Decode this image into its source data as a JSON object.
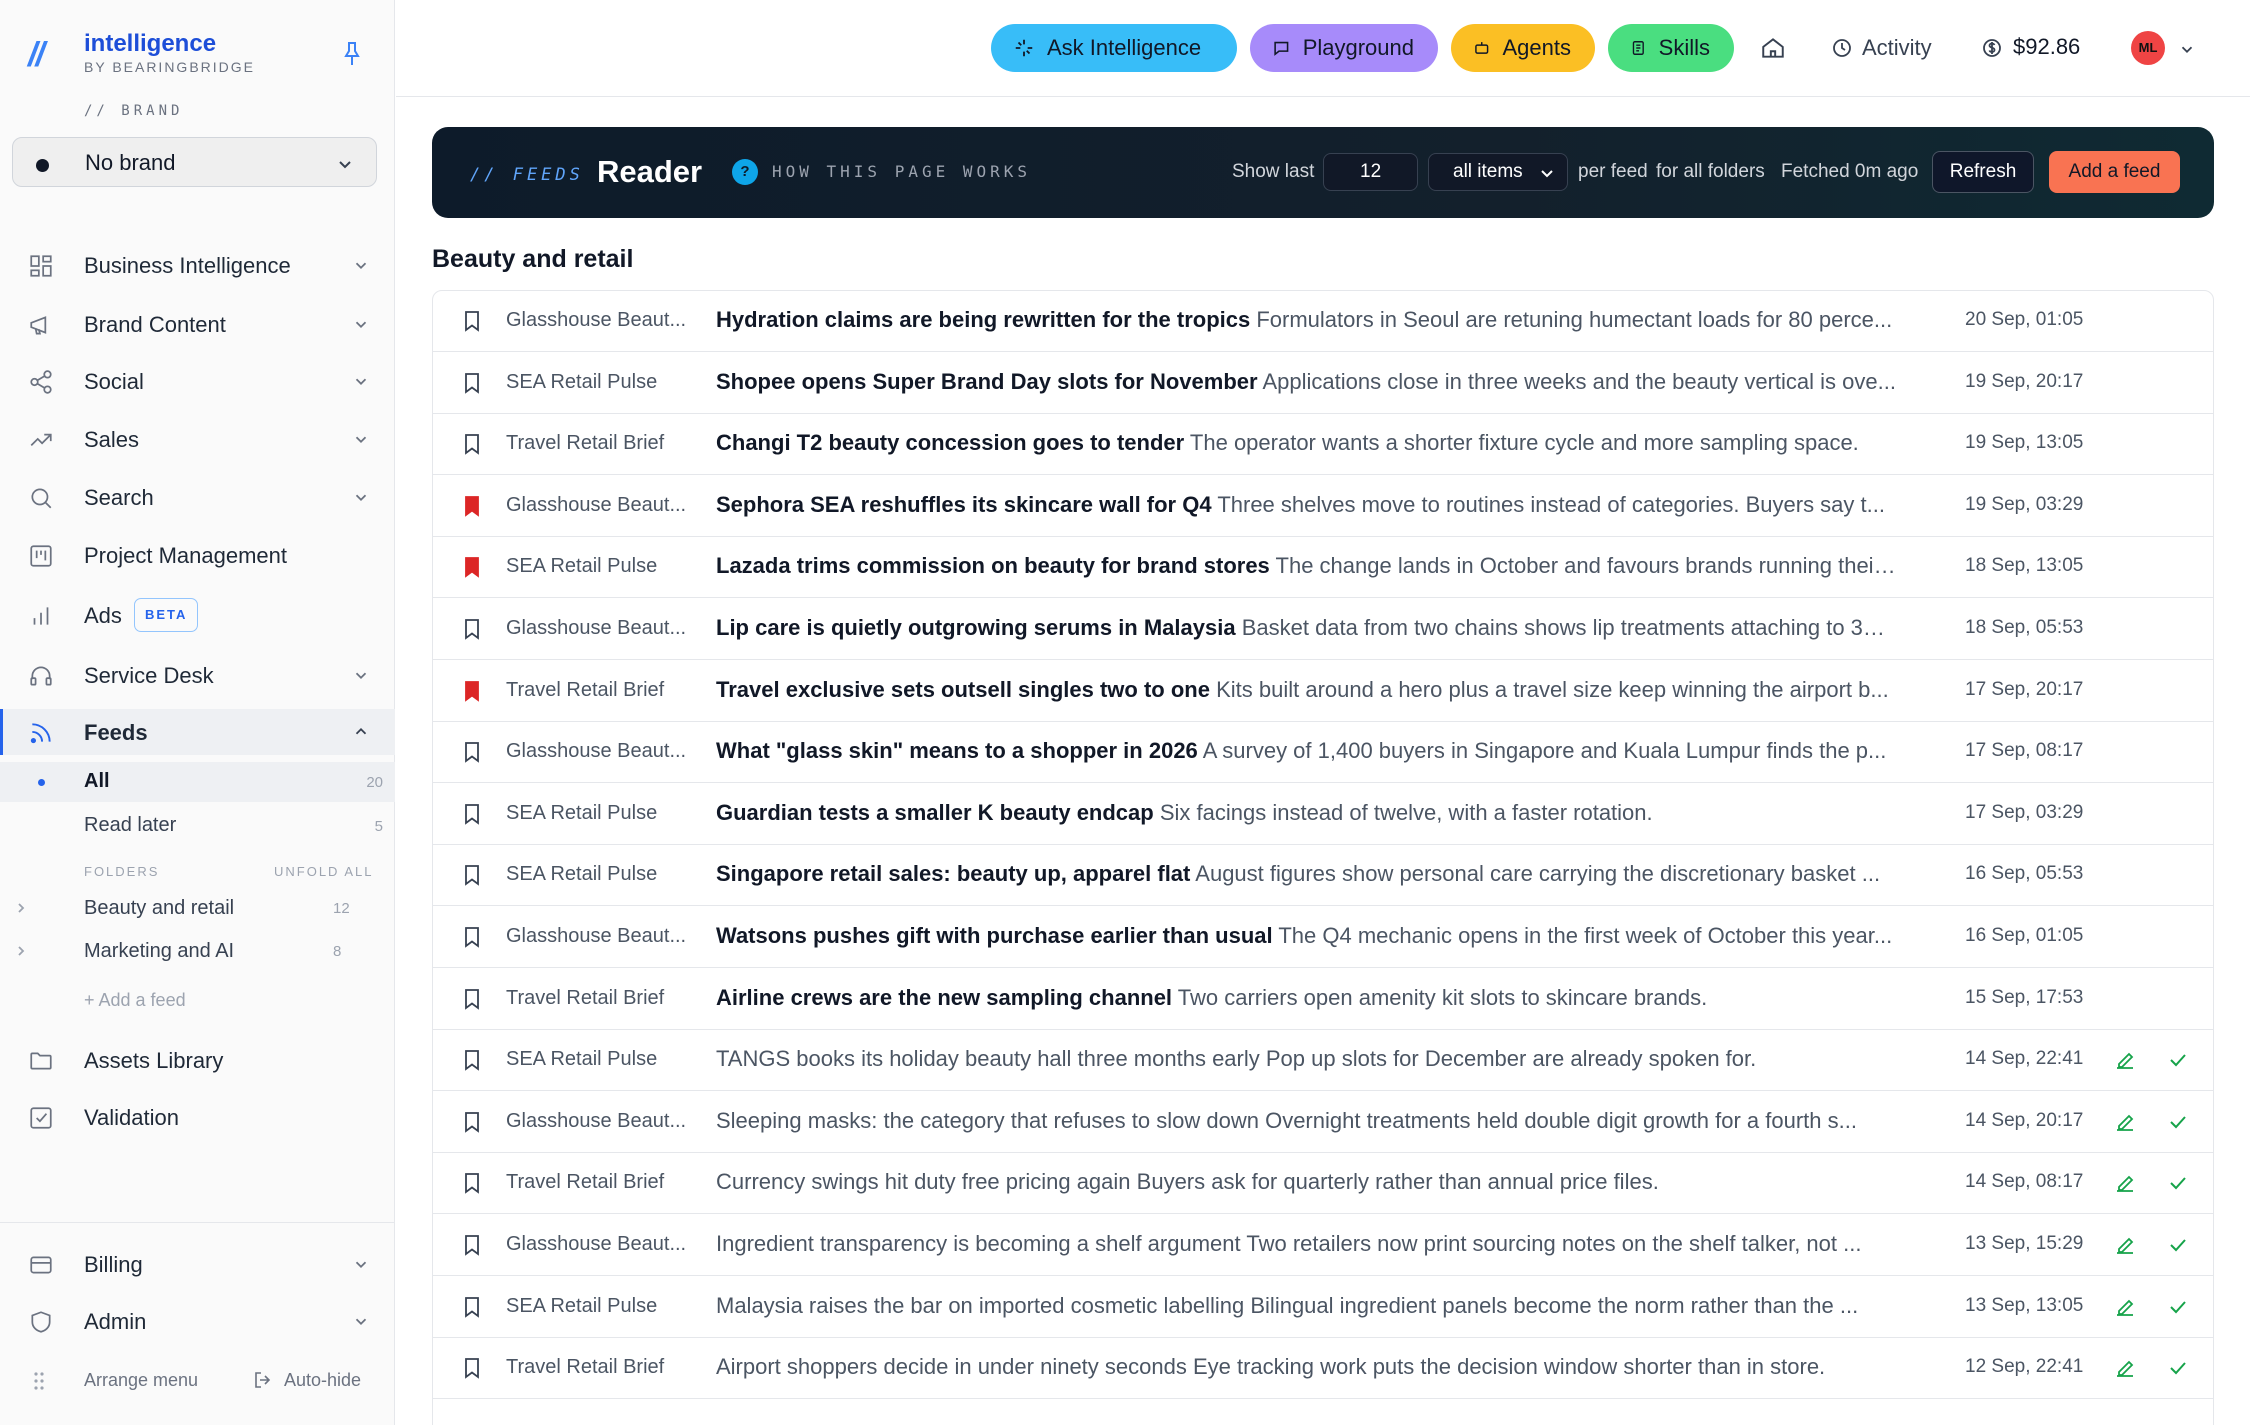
{
  "app": {
    "logo_mark": "//",
    "name": "intelligence",
    "tagline": "BY BEARINGBRIDGE"
  },
  "sidebar": {
    "brand_caption": "// BRAND",
    "brand_value": "No brand",
    "nav": [
      {
        "label": "Business Intelligence",
        "icon": "grid-icon"
      },
      {
        "label": "Brand Content",
        "icon": "megaphone-icon"
      },
      {
        "label": "Social",
        "icon": "share-icon"
      },
      {
        "label": "Sales",
        "icon": "trend-up-icon"
      },
      {
        "label": "Search",
        "icon": "search-icon"
      },
      {
        "label": "Project Management",
        "icon": "kanban-icon"
      },
      {
        "label": "Ads",
        "icon": "bar-chart-icon",
        "badge": "BETA"
      },
      {
        "label": "Service Desk",
        "icon": "headset-icon"
      },
      {
        "label": "Feeds",
        "icon": "rss-icon"
      }
    ],
    "feeds_sub": [
      {
        "label": "All",
        "count": "20"
      },
      {
        "label": "Read later",
        "count": "5"
      }
    ],
    "folders_heading": "FOLDERS",
    "unfold_all": "UNFOLD ALL",
    "folders": [
      {
        "label": "Beauty and retail",
        "count": "12"
      },
      {
        "label": "Marketing and AI",
        "count": "8"
      }
    ],
    "add_feed": "+ Add a feed",
    "nav_bottom": [
      {
        "label": "Assets Library",
        "icon": "folder-icon"
      },
      {
        "label": "Validation",
        "icon": "checkbox-icon"
      }
    ],
    "footer_nav": [
      {
        "label": "Billing",
        "icon": "card-icon"
      },
      {
        "label": "Admin",
        "icon": "shield-icon"
      }
    ],
    "arrange_menu": "Arrange menu",
    "auto_hide": "Auto-hide"
  },
  "topbar": {
    "ask": "Ask Intelligence",
    "playground": "Playground",
    "agents": "Agents",
    "skills": "Skills",
    "activity": "Activity",
    "balance": "$92.86",
    "avatar_initials": "ML"
  },
  "header": {
    "kicker": "// FEEDS",
    "title": "Reader",
    "help_badge": "?",
    "help_text": "HOW THIS PAGE WORKS",
    "show_last": "Show last",
    "count": "12",
    "filter": "all items",
    "per_feed": "per feed",
    "scope": "for all folders",
    "fetched": "Fetched 0m ago",
    "refresh": "Refresh",
    "add_feed": "Add a feed"
  },
  "section_title": "Beauty and retail",
  "feed_items": [
    {
      "source": "Glasshouse Beaut...",
      "title": "Hydration claims are being rewritten for the tropics",
      "summary": "Formulators in Seoul are retuning humectant loads for 80 perce...",
      "date": "20 Sep, 01:05",
      "saved": false,
      "read": false
    },
    {
      "source": "SEA Retail Pulse",
      "title": "Shopee opens Super Brand Day slots for November",
      "summary": "Applications close in three weeks and the beauty vertical is ove...",
      "date": "19 Sep, 20:17",
      "saved": false,
      "read": false
    },
    {
      "source": "Travel Retail Brief",
      "title": "Changi T2 beauty concession goes to tender",
      "summary": "The operator wants a shorter fixture cycle and more sampling space.",
      "date": "19 Sep, 13:05",
      "saved": false,
      "read": false
    },
    {
      "source": "Glasshouse Beaut...",
      "title": "Sephora SEA reshuffles its skincare wall for Q4",
      "summary": "Three shelves move to routines instead of categories. Buyers say t...",
      "date": "19 Sep, 03:29",
      "saved": true,
      "read": false
    },
    {
      "source": "SEA Retail Pulse",
      "title": "Lazada trims commission on beauty for brand stores",
      "summary": "The change lands in October and favours brands running their...",
      "date": "18 Sep, 13:05",
      "saved": true,
      "read": false
    },
    {
      "source": "Glasshouse Beaut...",
      "title": "Lip care is quietly outgrowing serums in Malaysia",
      "summary": "Basket data from two chains shows lip treatments attaching to 31 ...",
      "date": "18 Sep, 05:53",
      "saved": false,
      "read": false
    },
    {
      "source": "Travel Retail Brief",
      "title": "Travel exclusive sets outsell singles two to one",
      "summary": "Kits built around a hero plus a travel size keep winning the airport b...",
      "date": "17 Sep, 20:17",
      "saved": true,
      "read": false
    },
    {
      "source": "Glasshouse Beaut...",
      "title": "What \"glass skin\" means to a shopper in 2026",
      "summary": "A survey of 1,400 buyers in Singapore and Kuala Lumpur finds the p...",
      "date": "17 Sep, 08:17",
      "saved": false,
      "read": false
    },
    {
      "source": "SEA Retail Pulse",
      "title": "Guardian tests a smaller K beauty endcap",
      "summary": "Six facings instead of twelve, with a faster rotation.",
      "date": "17 Sep, 03:29",
      "saved": false,
      "read": false
    },
    {
      "source": "SEA Retail Pulse",
      "title": "Singapore retail sales: beauty up, apparel flat",
      "summary": "August figures show personal care carrying the discretionary basket ...",
      "date": "16 Sep, 05:53",
      "saved": false,
      "read": false
    },
    {
      "source": "Glasshouse Beaut...",
      "title": "Watsons pushes gift with purchase earlier than usual",
      "summary": "The Q4 mechanic opens in the first week of October this year...",
      "date": "16 Sep, 01:05",
      "saved": false,
      "read": false
    },
    {
      "source": "Travel Retail Brief",
      "title": "Airline crews are the new sampling channel",
      "summary": "Two carriers open amenity kit slots to skincare brands.",
      "date": "15 Sep, 17:53",
      "saved": false,
      "read": false
    },
    {
      "source": "SEA Retail Pulse",
      "title": "TANGS books its holiday beauty hall three months early",
      "summary": "Pop up slots for December are already spoken for.",
      "date": "14 Sep, 22:41",
      "saved": false,
      "read": true
    },
    {
      "source": "Glasshouse Beaut...",
      "title": "Sleeping masks: the category that refuses to slow down",
      "summary": "Overnight treatments held double digit growth for a fourth s...",
      "date": "14 Sep, 20:17",
      "saved": false,
      "read": true
    },
    {
      "source": "Travel Retail Brief",
      "title": "Currency swings hit duty free pricing again",
      "summary": "Buyers ask for quarterly rather than annual price files.",
      "date": "14 Sep, 08:17",
      "saved": false,
      "read": true
    },
    {
      "source": "Glasshouse Beaut...",
      "title": "Ingredient transparency is becoming a shelf argument",
      "summary": "Two retailers now print sourcing notes on the shelf talker, not ...",
      "date": "13 Sep, 15:29",
      "saved": false,
      "read": true
    },
    {
      "source": "SEA Retail Pulse",
      "title": "Malaysia raises the bar on imported cosmetic labelling",
      "summary": "Bilingual ingredient panels become the norm rather than the ...",
      "date": "13 Sep, 13:05",
      "saved": false,
      "read": true
    },
    {
      "source": "Travel Retail Brief",
      "title": "Airport shoppers decide in under ninety seconds",
      "summary": "Eye tracking work puts the decision window shorter than in store.",
      "date": "12 Sep, 22:41",
      "saved": false,
      "read": true
    }
  ],
  "colors": {
    "accent": "#2563eb",
    "saved_bookmark": "#dc2626",
    "read_check": "#16a34a"
  }
}
